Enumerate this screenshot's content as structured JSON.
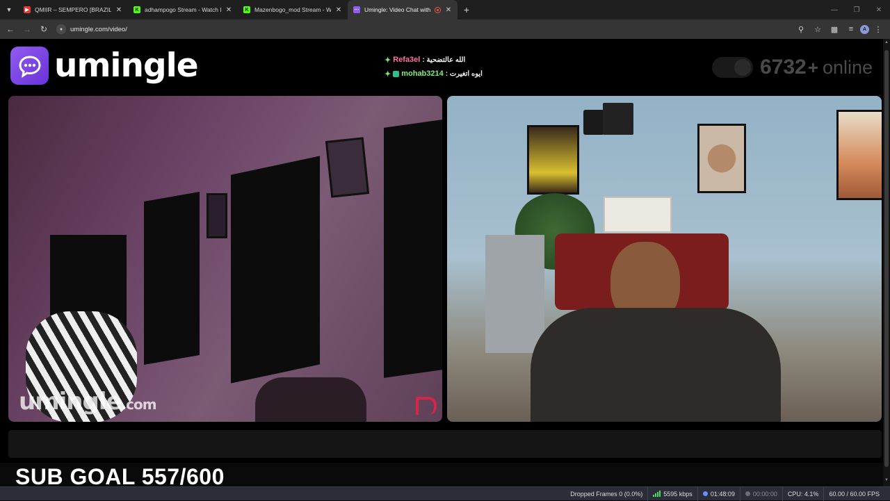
{
  "browser": {
    "tabs": [
      {
        "title": "QMIIR – SEMPERO [BRAZILIAN",
        "favicon_color": "#e53935",
        "icon": "youtube-icon",
        "active": false
      },
      {
        "title": "adhampogo Stream - Watch Li",
        "favicon_color": "#53fc18",
        "icon": "kick-icon",
        "active": false
      },
      {
        "title": "Mazenbogo_mod Stream - Wa",
        "favicon_color": "#53fc18",
        "icon": "kick-icon",
        "active": false
      },
      {
        "title": "Umingle: Video Chat with S",
        "favicon_color": "#8f5cf0",
        "icon": "umingle-icon",
        "active": true
      }
    ],
    "new_tab": "+",
    "url": "umingle.com/video/"
  },
  "page": {
    "logo_text": "umingle",
    "chat": [
      {
        "name": "Refa3el",
        "message": "الله عالتضحية :"
      },
      {
        "name": "mohab3214",
        "message": "ايوه اتغيرت :"
      }
    ],
    "online": {
      "count": "6732",
      "plus": "+",
      "label": "online"
    },
    "watermark": {
      "brand": "umingle",
      "tld": ".com"
    },
    "sub_goal": "SUB GOAL 557/600"
  },
  "obs_status": {
    "dropped_frames": "Dropped Frames 0 (0.0%)",
    "bitrate": "5595 kbps",
    "stream_time": "01:48:09",
    "record_time": "00:00:00",
    "cpu": "CPU: 4.1%",
    "fps": "60.00 / 60.00 FPS"
  },
  "colors": {
    "accent": "#8f5cf0",
    "chat_name_1": "#ff6fa3",
    "chat_name_2": "#7ef07a",
    "bitrate_ok": "#4cd964"
  }
}
